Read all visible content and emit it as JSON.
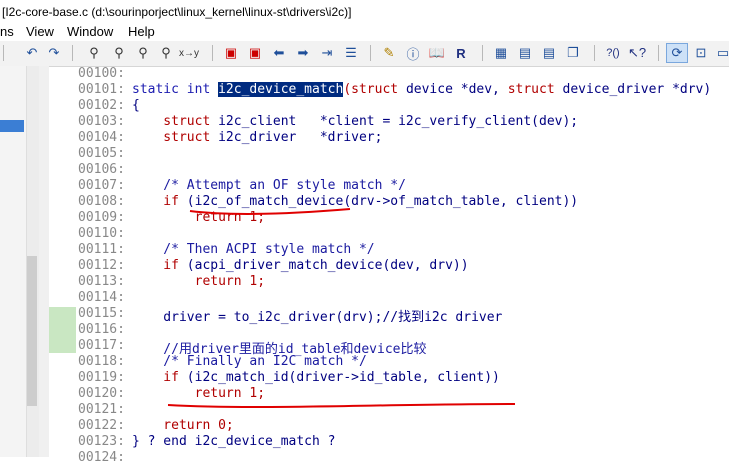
{
  "window": {
    "title": "[I2c-core-base.c (d:\\sourinporject\\linux_kernel\\linux-st\\drivers\\i2c)]"
  },
  "menu": [
    {
      "label": "ns",
      "key": "n"
    },
    {
      "label": "View",
      "key": "V"
    },
    {
      "label": "Window",
      "key": "W"
    },
    {
      "label": "Help",
      "key": "H"
    }
  ],
  "toolbar": {
    "icons": [
      "undo-icon",
      "redo-icon",
      "find-icon",
      "find-next-icon",
      "find-prev-icon",
      "replace-icon",
      "bookmark-icon",
      "bookmark-next-icon",
      "back-icon",
      "forward-icon",
      "jump-icon",
      "jump-list-icon",
      "symbol-icon",
      "info-icon",
      "book-icon",
      "relation-icon",
      "layout1-icon",
      "layout2-icon",
      "layout3-icon",
      "window-icon",
      "lookup-icon",
      "help-icon",
      "sync-icon",
      "overview-icon"
    ]
  },
  "code": {
    "lines": [
      {
        "no": "00100:",
        "text": ""
      },
      {
        "no": "00101:",
        "text": "static int i2c_device_match(struct device *dev, struct device_driver *drv)"
      },
      {
        "no": "00102:",
        "text": "{"
      },
      {
        "no": "00103:",
        "text": "    struct i2c_client   *client = i2c_verify_client(dev);"
      },
      {
        "no": "00104:",
        "text": "    struct i2c_driver   *driver;"
      },
      {
        "no": "00105:",
        "text": ""
      },
      {
        "no": "00106:",
        "text": ""
      },
      {
        "no": "00107:",
        "text": "    /* Attempt an OF style match */"
      },
      {
        "no": "00108:",
        "text": "    if (i2c_of_match_device(drv->of_match_table, client))"
      },
      {
        "no": "00109:",
        "text": "        return 1;"
      },
      {
        "no": "00110:",
        "text": ""
      },
      {
        "no": "00111:",
        "text": "    /* Then ACPI style match */"
      },
      {
        "no": "00112:",
        "text": "    if (acpi_driver_match_device(dev, drv))"
      },
      {
        "no": "00113:",
        "text": "        return 1;"
      },
      {
        "no": "00114:",
        "text": ""
      },
      {
        "no": "00115:",
        "text": "    driver = to_i2c_driver(drv);//找到i2c driver"
      },
      {
        "no": "00116:",
        "text": ""
      },
      {
        "no": "00117:",
        "text": "    //用driver里面的id_table和device比较"
      },
      {
        "no": "00118:",
        "text": "    /* Finally an I2C match */"
      },
      {
        "no": "00119:",
        "text": "    if (i2c_match_id(driver->id_table, client))"
      },
      {
        "no": "00120:",
        "text": "        return 1;"
      },
      {
        "no": "00121:",
        "text": ""
      },
      {
        "no": "00122:",
        "text": "    return 0;"
      },
      {
        "no": "00123:",
        "text": "} ? end i2c_device_match ?"
      },
      {
        "no": "00124:",
        "text": ""
      }
    ]
  },
  "colors": {
    "selection": "#002b80",
    "annotation": "#e00000",
    "modified_marker": "#c9e7c2"
  }
}
